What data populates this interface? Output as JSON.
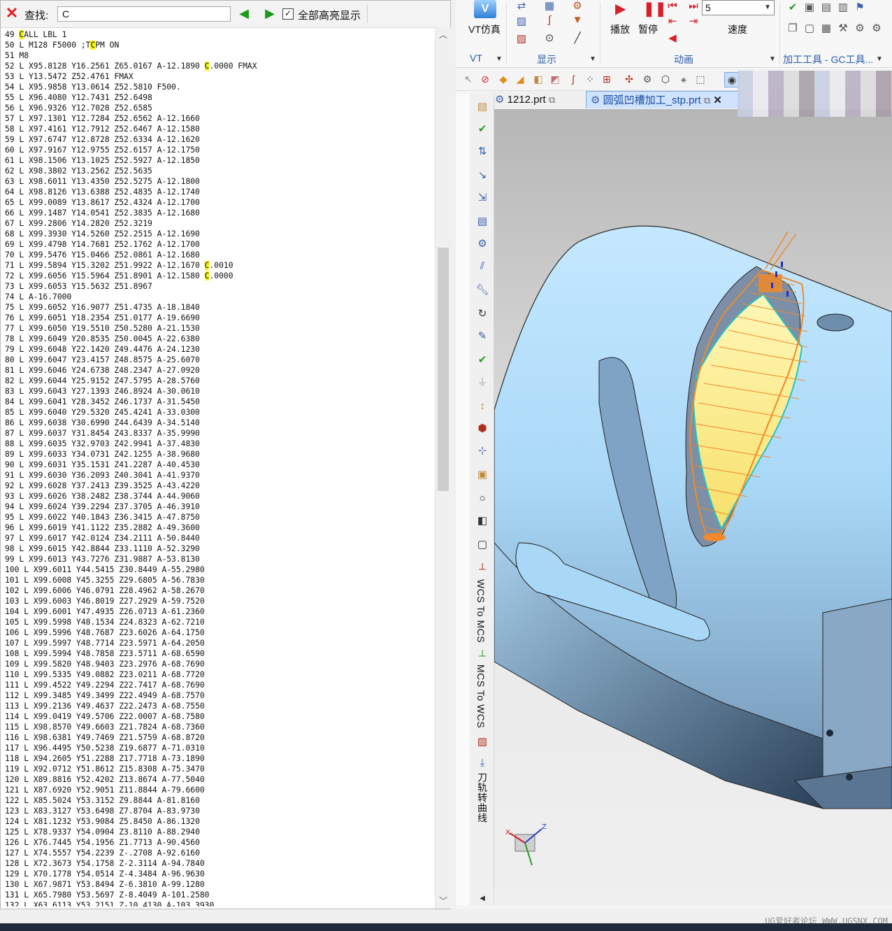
{
  "find": {
    "label": "查找:",
    "value": "C",
    "highlight_all_label": "全部高亮显示",
    "highlight_all_checked": true
  },
  "code_lines": [
    "49 CALL LBL 1",
    "50 L M128 F5000 ;TCPM ON",
    "51 M8",
    "52 L X95.8128 Y16.2561 Z65.0167 A-12.1890 C.0000 FMAX",
    "53 L Y13.5472 Z52.4761 FMAX",
    "54 L X95.9858 Y13.0614 Z52.5810 F500.",
    "55 L X96.4080 Y12.7431 Z52.6498",
    "56 L X96.9326 Y12.7028 Z52.6585",
    "57 L X97.1301 Y12.7284 Z52.6562 A-12.1660",
    "58 L X97.4161 Y12.7912 Z52.6467 A-12.1580",
    "59 L X97.6747 Y12.8728 Z52.6334 A-12.1620",
    "60 L X97.9167 Y12.9755 Z52.6157 A-12.1750",
    "61 L X98.1506 Y13.1025 Z52.5927 A-12.1850",
    "62 L X98.3802 Y13.2562 Z52.5635",
    "63 L X98.6011 Y13.4350 Z52.5275 A-12.1800",
    "64 L X98.8126 Y13.6388 Z52.4835 A-12.1740",
    "65 L X99.0089 Y13.8617 Z52.4324 A-12.1700",
    "66 L X99.1487 Y14.0541 Z52.3835 A-12.1680",
    "67 L X99.2806 Y14.2820 Z52.3219",
    "68 L X99.3930 Y14.5260 Z52.2515 A-12.1690",
    "69 L X99.4798 Y14.7681 Z52.1762 A-12.1700",
    "70 L X99.5476 Y15.0466 Z52.0861 A-12.1680",
    "71 L X99.5894 Y15.3202 Z51.9922 A-12.1670 C.0010",
    "72 L X99.6056 Y15.5964 Z51.8901 A-12.1580 C.0000",
    "73 L X99.6053 Y15.5632 Z51.8967",
    "74 L A-16.7000",
    "75 L X99.6052 Y16.9077 Z51.4735 A-18.1840",
    "76 L X99.6051 Y18.2354 Z51.0177 A-19.6690",
    "77 L X99.6050 Y19.5510 Z50.5280 A-21.1530",
    "78 L X99.6049 Y20.8535 Z50.0045 A-22.6380",
    "79 L X99.6048 Y22.1420 Z49.4476 A-24.1230",
    "80 L X99.6047 Y23.4157 Z48.8575 A-25.6070",
    "81 L X99.6046 Y24.6738 Z48.2347 A-27.0920",
    "82 L X99.6044 Y25.9152 Z47.5795 A-28.5760",
    "83 L X99.6043 Y27.1393 Z46.8924 A-30.0610",
    "84 L X99.6041 Y28.3452 Z46.1737 A-31.5450",
    "85 L X99.6040 Y29.5320 Z45.4241 A-33.0300",
    "86 L X99.6038 Y30.6990 Z44.6439 A-34.5140",
    "87 L X99.6037 Y31.8454 Z43.8337 A-35.9990",
    "88 L X99.6035 Y32.9703 Z42.9941 A-37.4830",
    "89 L X99.6033 Y34.0731 Z42.1255 A-38.9680",
    "90 L X99.6031 Y35.1531 Z41.2287 A-40.4530",
    "91 L X99.6030 Y36.2093 Z40.3041 A-41.9370",
    "92 L X99.6028 Y37.2413 Z39.3525 A-43.4220",
    "93 L X99.6026 Y38.2482 Z38.3744 A-44.9060",
    "94 L X99.6024 Y39.2294 Z37.3705 A-46.3910",
    "95 L X99.6022 Y40.1843 Z36.3415 A-47.8750",
    "96 L X99.6019 Y41.1122 Z35.2882 A-49.3600",
    "97 L X99.6017 Y42.0124 Z34.2111 A-50.8440",
    "98 L X99.6015 Y42.8844 Z33.1110 A-52.3290",
    "99 L X99.6013 Y43.7276 Z31.9887 A-53.8130",
    "100 L X99.6011 Y44.5415 Z30.8449 A-55.2980",
    "101 L X99.6008 Y45.3255 Z29.6805 A-56.7830",
    "102 L X99.6006 Y46.0791 Z28.4962 A-58.2670",
    "103 L X99.6003 Y46.8019 Z27.2929 A-59.7520",
    "104 L X99.6001 Y47.4935 Z26.0713 A-61.2360",
    "105 L X99.5998 Y48.1534 Z24.8323 A-62.7210",
    "106 L X99.5996 Y48.7687 Z23.6026 A-64.1750",
    "107 L X99.5997 Y48.7714 Z23.5971 A-64.2050",
    "108 L X99.5994 Y48.7858 Z23.5711 A-68.6590",
    "109 L X99.5820 Y48.9403 Z23.2976 A-68.7690",
    "110 L X99.5335 Y49.0882 Z23.0211 A-68.7720",
    "111 L X99.4522 Y49.2294 Z22.7417 A-68.7690",
    "112 L X99.3485 Y49.3499 Z22.4949 A-68.7570",
    "113 L X99.2136 Y49.4637 Z22.2473 A-68.7550",
    "114 L X99.0419 Y49.5706 Z22.0007 A-68.7580",
    "115 L X98.8570 Y49.6603 Z21.7824 A-68.7360",
    "116 L X98.6381 Y49.7469 Z21.5759 A-68.8720",
    "117 L X96.4495 Y50.5238 Z19.6877 A-71.0310",
    "118 L X94.2605 Y51.2288 Z17.7718 A-73.1890",
    "119 L X92.0712 Y51.8612 Z15.8308 A-75.3470",
    "120 L X89.8816 Y52.4202 Z13.8674 A-77.5040",
    "121 L X87.6920 Y52.9051 Z11.8844 A-79.6600",
    "122 L X85.5024 Y53.3152 Z9.8844 A-81.8160",
    "123 L X83.3127 Y53.6498 Z7.8704 A-83.9730",
    "124 L X81.1232 Y53.9084 Z5.8450 A-86.1320",
    "125 L X78.9337 Y54.0904 Z3.8110 A-88.2940",
    "126 L X76.7445 Y54.1956 Z1.7713 A-90.4560",
    "127 L X74.5557 Y54.2239 Z-.2708 A-92.6160",
    "128 L X72.3673 Y54.1758 Z-2.3114 A-94.7840",
    "129 L X70.1778 Y54.0514 Z-4.3484 A-96.9630",
    "130 L X67.9871 Y53.8494 Z-6.3810 A-99.1280",
    "131 L X65.7980 Y53.5697 Z-8.4049 A-101.2580",
    "132 L X63.6113 Y53.2151 Z-10.4130 A-103.3930"
  ],
  "ribbon": {
    "vt_label": "VT仿真",
    "vt_group": "VT",
    "display_group": "显示",
    "play_label": "播放",
    "pause_label": "暂停",
    "speed_value": "5",
    "speed_label": "速度",
    "anim_group": "动画",
    "tools_group": "加工工具 - GC工具..."
  },
  "tabs": [
    {
      "label": "1212.prt"
    },
    {
      "label": "圆弧凹槽加工_stp.prt"
    }
  ],
  "side_vertical_labels": {
    "wcs_to_mcs": "WCS To MCS",
    "mcs_to_wcs": "MCS To WCS",
    "toolpath_curve": "刀轨转曲线"
  },
  "watermark": "UG爱好者论坛 WWW.UGSNX.COM",
  "colors": {
    "highlight": "#f7f300",
    "part_blue": "#a9d8f7",
    "pocket_yellow": "#fff39a",
    "toolpath_orange": "#f08a2a",
    "toolpath_cyan": "#21c6c6",
    "group_label": "#2a5aa8"
  }
}
